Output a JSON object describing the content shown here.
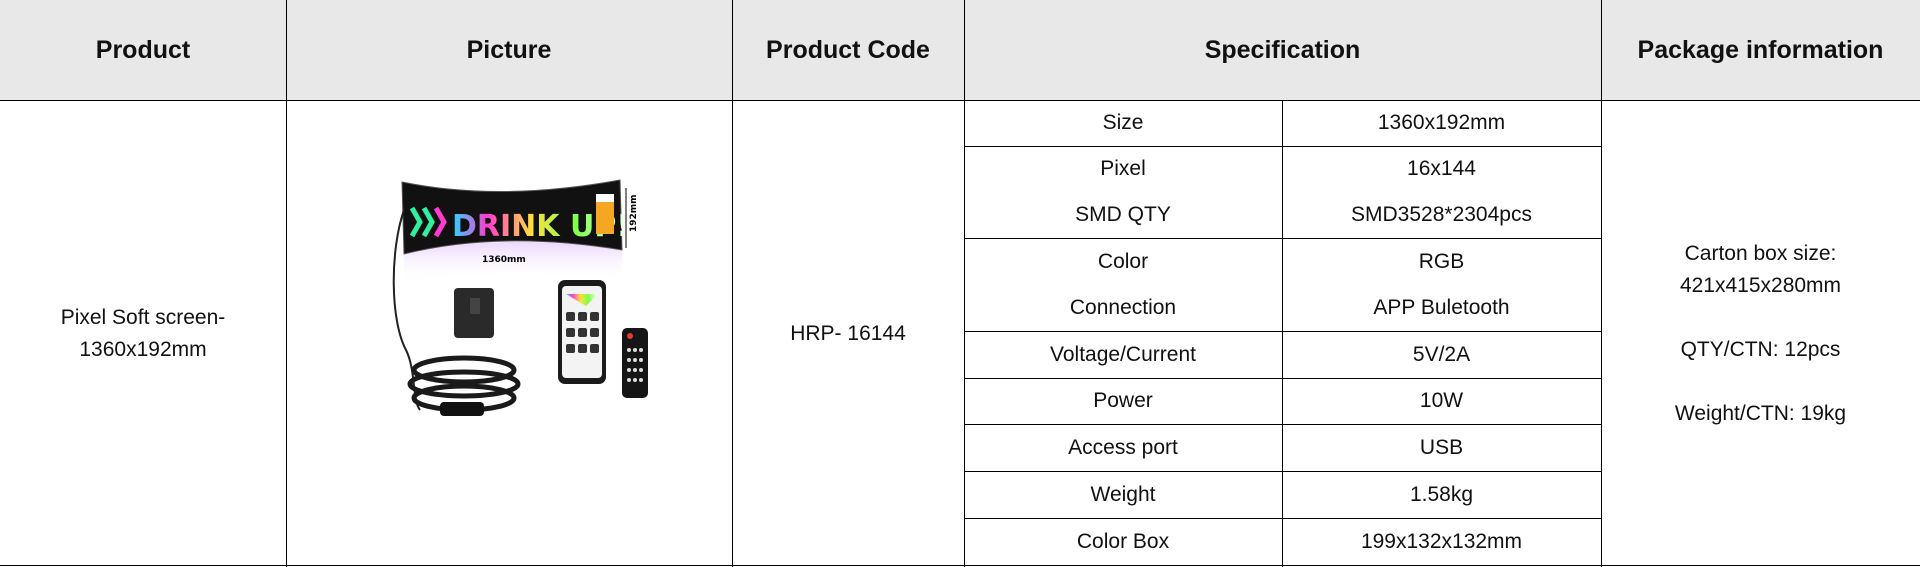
{
  "headers": {
    "product": "Product",
    "picture": "Picture",
    "product_code": "Product Code",
    "specification": "Specification",
    "package": "Package information"
  },
  "row": {
    "product_line1": "Pixel Soft screen-",
    "product_line2": "1360x192mm",
    "product_code": "HRP- 16144"
  },
  "specs": [
    {
      "label": "Size",
      "value": "1360x192mm"
    },
    {
      "label": "Pixel",
      "value": "16x144"
    },
    {
      "label": "SMD QTY",
      "value": "SMD3528*2304pcs"
    },
    {
      "label": "Color",
      "value": "RGB"
    },
    {
      "label": "Connection",
      "value": "APP Buletooth"
    },
    {
      "label": "Voltage/Current",
      "value": "5V/2A"
    },
    {
      "label": "Power",
      "value": "10W"
    },
    {
      "label": "Access port",
      "value": "USB"
    },
    {
      "label": "Weight",
      "value": "1.58kg"
    },
    {
      "label": "Color Box",
      "value": "199x132x132mm"
    }
  ],
  "package": {
    "carton_line1": "Carton box size:",
    "carton_line2": "421x415x280mm",
    "qty": "QTY/CTN: 12pcs",
    "weight": "Weight/CTN: 19kg"
  },
  "picture": {
    "banner_text": "DRINK UP!",
    "width_label": "1360mm",
    "height_label": "192mm",
    "icon": "led-screen-product-photo"
  }
}
